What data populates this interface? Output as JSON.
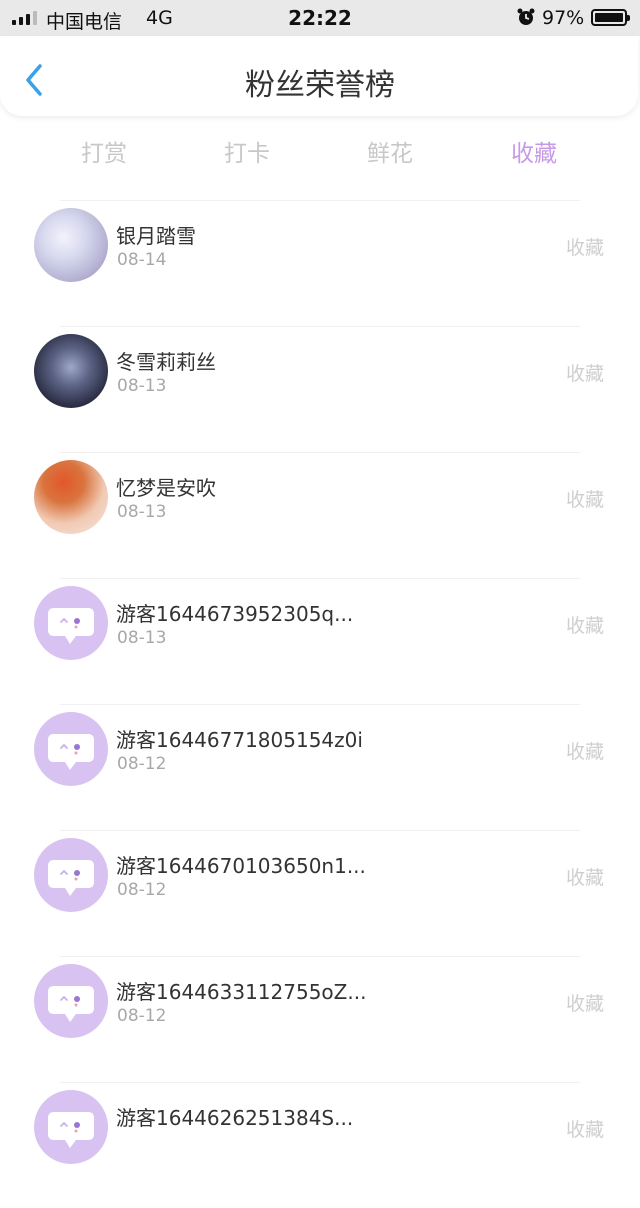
{
  "status_bar": {
    "carrier": "中国电信",
    "network": "4G",
    "time": "22:22",
    "battery": "97%"
  },
  "header": {
    "title": "粉丝荣誉榜"
  },
  "tabs": [
    {
      "label": "打赏",
      "active": false
    },
    {
      "label": "打卡",
      "active": false
    },
    {
      "label": "鲜花",
      "active": false
    },
    {
      "label": "收藏",
      "active": true
    }
  ],
  "colors": {
    "accent": "#c79ae8",
    "guest_avatar": "#d7c2f2"
  },
  "list": [
    {
      "name": "银月踏雪",
      "date": "08-14",
      "action": "收藏",
      "avatar": "photo-pale"
    },
    {
      "name": "冬雪莉莉丝",
      "date": "08-13",
      "action": "收藏",
      "avatar": "photo-dark"
    },
    {
      "name": "忆梦是安吹",
      "date": "08-13",
      "action": "收藏",
      "avatar": "photo-redhair"
    },
    {
      "name": "游客1644673952305q...",
      "date": "08-13",
      "action": "收藏",
      "avatar": "guest-chat-icon"
    },
    {
      "name": "游客16446771805154z0i",
      "date": "08-12",
      "action": "收藏",
      "avatar": "guest-chat-icon"
    },
    {
      "name": "游客1644670103650n1...",
      "date": "08-12",
      "action": "收藏",
      "avatar": "guest-chat-icon"
    },
    {
      "name": "游客1644633112755oZ...",
      "date": "08-12",
      "action": "收藏",
      "avatar": "guest-chat-icon"
    },
    {
      "name": "游客1644626251384S...",
      "date": "",
      "action": "收藏",
      "avatar": "guest-chat-icon"
    }
  ]
}
